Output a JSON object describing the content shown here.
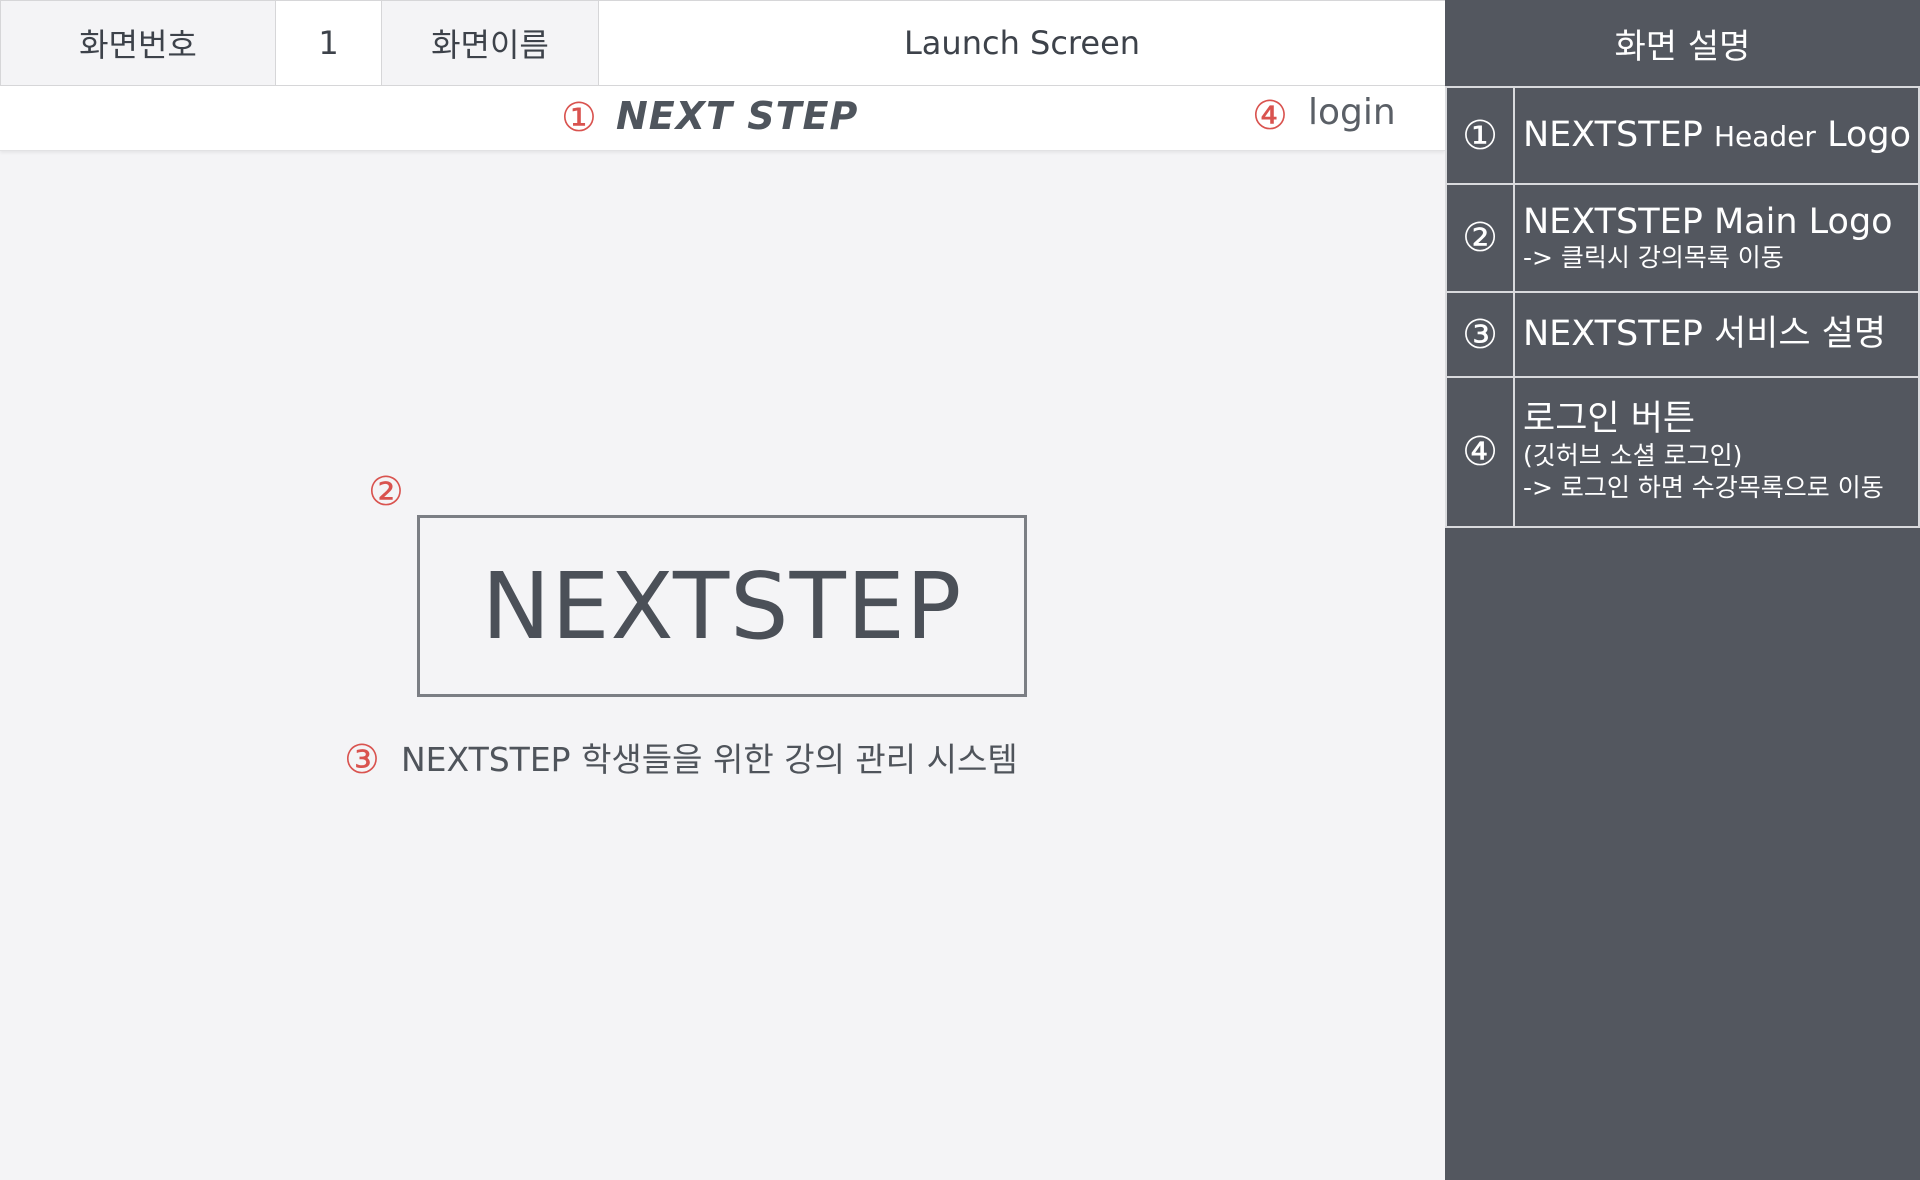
{
  "header": {
    "screen_no_label": "화면번호",
    "screen_no": "1",
    "screen_name_label": "화면이름",
    "screen_name": "Launch Screen"
  },
  "navbar": {
    "marker_logo": "①",
    "logo": "NEXT STEP",
    "marker_login": "④",
    "login": "login"
  },
  "main": {
    "marker_logo": "②",
    "logo": "NEXTSTEP",
    "marker_desc": "③",
    "description": "NEXTSTEP 학생들을 위한 강의 관리 시스템"
  },
  "panel": {
    "title": "화면 설명",
    "items": [
      {
        "num": "①",
        "main_a": "NEXTSTEP ",
        "main_b": "Header",
        "main_c": " Logo"
      },
      {
        "num": "②",
        "main": "NEXTSTEP Main Logo",
        "sub1": "-> 클릭시 강의목록 이동"
      },
      {
        "num": "③",
        "main": "NEXTSTEP 서비스 설명"
      },
      {
        "num": "④",
        "main": "로그인 버튼",
        "sub1": "(깃허브 소셜 로그인)",
        "sub2": "-> 로그인 하면 수강목록으로 이동"
      }
    ]
  },
  "colors": {
    "marker": "#d9534f",
    "panel_bg": "#53575f",
    "page_bg": "#f4f4f6"
  }
}
